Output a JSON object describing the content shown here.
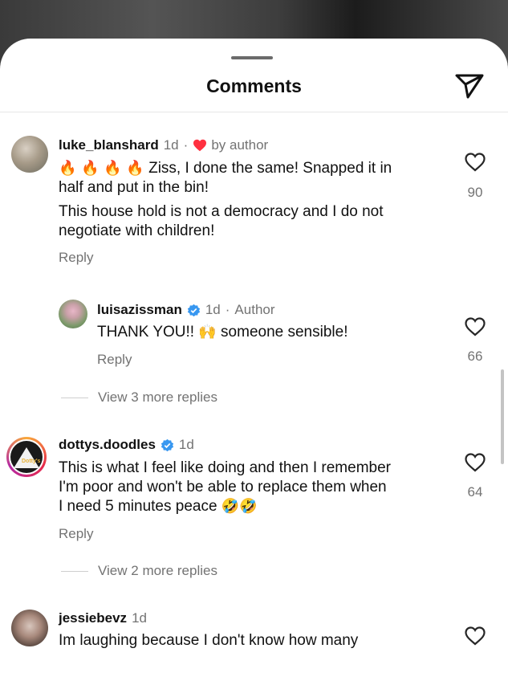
{
  "header": {
    "title": "Comments"
  },
  "comments": [
    {
      "username": "luke_blanshard",
      "time": "1d",
      "by_author_label": "by author",
      "text_line1_emoji": "🔥 🔥 🔥 🔥",
      "text_line1": " Ziss, I done the same!  Snapped it in",
      "text_line2": "half and put in the bin!",
      "text_line3": "This house hold is not a democracy and I do not",
      "text_line4": "negotiate with children!",
      "reply_label": "Reply",
      "likes": "90"
    },
    {
      "username": "luisazissman",
      "verified": true,
      "time": "1d",
      "author_label": "Author",
      "text_pre": "THANK YOU!! ",
      "text_emoji": "🙌",
      "text_post": " someone sensible!",
      "reply_label": "Reply",
      "likes": "66",
      "view_more": "View 3 more replies"
    },
    {
      "username": "dottys.doodles",
      "verified": true,
      "time": "1d",
      "avatar_text": "Dotty's",
      "text_line1": "This is what I feel like doing and then I remember",
      "text_line2": "I'm poor and won't be able to replace them when",
      "text_line3": "I need 5 minutes peace ",
      "text_line3_emoji": "🤣🤣",
      "reply_label": "Reply",
      "likes": "64",
      "view_more": "View 2 more replies"
    },
    {
      "username": "jessiebevz",
      "time": "1d",
      "text_line1": "Im laughing because I don't know how many"
    }
  ],
  "icons": {
    "share": "paper-plane-icon",
    "like": "heart-outline-icon",
    "author_heart": "heart-filled-icon",
    "verified": "verified-badge-icon"
  },
  "colors": {
    "accent_verified": "#3797f0",
    "heart_red": "#ff3040",
    "secondary_text": "#737373"
  }
}
